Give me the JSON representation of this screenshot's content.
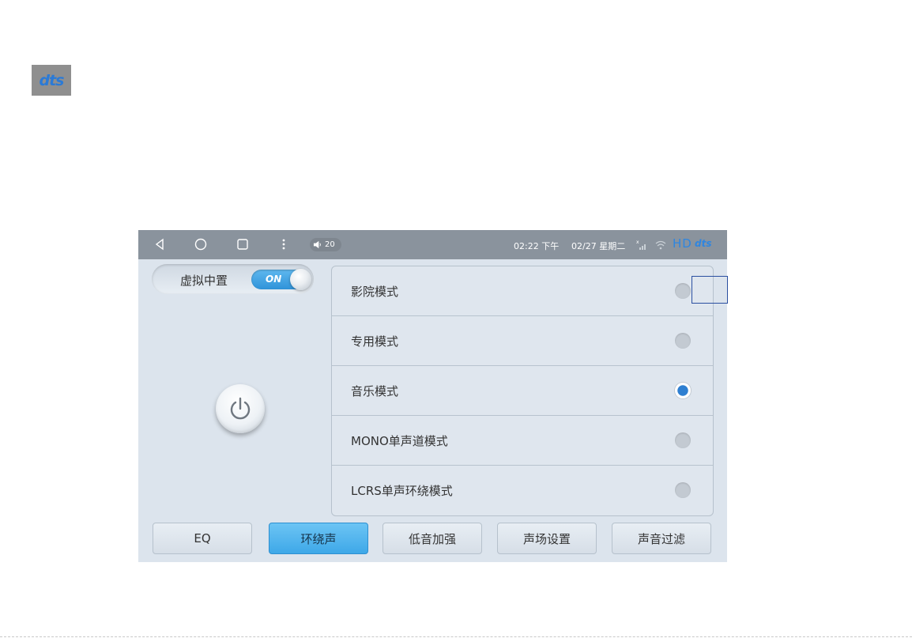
{
  "logo": {
    "text": "dts"
  },
  "statusbar": {
    "volume": "20",
    "time": "02:22 下午",
    "date": "02/27 星期二",
    "hd": "HD",
    "brand": "dts"
  },
  "left": {
    "toggle_label": "虚拟中置",
    "toggle_state": "ON"
  },
  "modes": [
    {
      "label": "影院模式",
      "selected": false
    },
    {
      "label": "专用模式",
      "selected": false
    },
    {
      "label": "音乐模式",
      "selected": true
    },
    {
      "label": "MONO单声道模式",
      "selected": false
    },
    {
      "label": "LCRS单声环绕模式",
      "selected": false
    }
  ],
  "tabs": [
    {
      "label": "EQ",
      "active": false
    },
    {
      "label": "环绕声",
      "active": true
    },
    {
      "label": "低音加强",
      "active": false
    },
    {
      "label": "声场设置",
      "active": false
    },
    {
      "label": "声音过滤",
      "active": false
    }
  ],
  "colors": {
    "accent": "#2f86e0",
    "statusbar_bg": "#8a939d",
    "screen_bg": "#dce4ed",
    "active_tab": "#4db3ee"
  }
}
